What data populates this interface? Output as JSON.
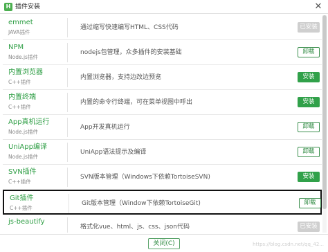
{
  "window": {
    "title": "插件安装",
    "app_icon_glyph": "H",
    "close_glyph": "✕"
  },
  "plugins": [
    {
      "name": "emmet",
      "platform": "JAVA插件",
      "description": "通过缩写快速编写HTML、CSS代码",
      "action": "已安装",
      "action_type": "installed"
    },
    {
      "name": "NPM",
      "platform": "Node.js插件",
      "description": "nodejs包管理，众多插件的安装基础",
      "action": "卸载",
      "action_type": "uninstall"
    },
    {
      "name": "内置浏览器",
      "platform": "C++插件",
      "description": "内置浏览器，支持边改边预览",
      "action": "安装",
      "action_type": "install"
    },
    {
      "name": "内置终端",
      "platform": "C++插件",
      "description": "内置的命令行终端，可在菜单视图中呼出",
      "action": "安装",
      "action_type": "install"
    },
    {
      "name": "App真机运行",
      "platform": "Node.js插件",
      "description": "App开发真机运行",
      "action": "卸载",
      "action_type": "uninstall"
    },
    {
      "name": "UniApp编译",
      "platform": "Node.js插件",
      "description": "UniApp语法提示及编译",
      "action": "卸载",
      "action_type": "uninstall"
    },
    {
      "name": "SVN插件",
      "platform": "C++插件",
      "description": "SVN版本管理（Windows下依赖TortoiseSVN)",
      "action": "安装",
      "action_type": "install"
    },
    {
      "name": "Git插件",
      "platform": "C++插件",
      "description": "Git版本管理（Window下依赖TortoiseGit)",
      "action": "卸载",
      "action_type": "uninstall"
    },
    {
      "name": "js-beautify",
      "platform": "",
      "description": "格式化vue、html、js、css、json代码",
      "action": "已安装",
      "action_type": "installed"
    }
  ],
  "selected_index": 7,
  "footer": {
    "close_label": "关闭(C)",
    "watermark": "https://blog.csdn.net/qq_42..."
  },
  "colors": {
    "accent_green": "#31a14a",
    "name_green": "#2e9e44",
    "installed_gray": "#cfcfcf"
  }
}
